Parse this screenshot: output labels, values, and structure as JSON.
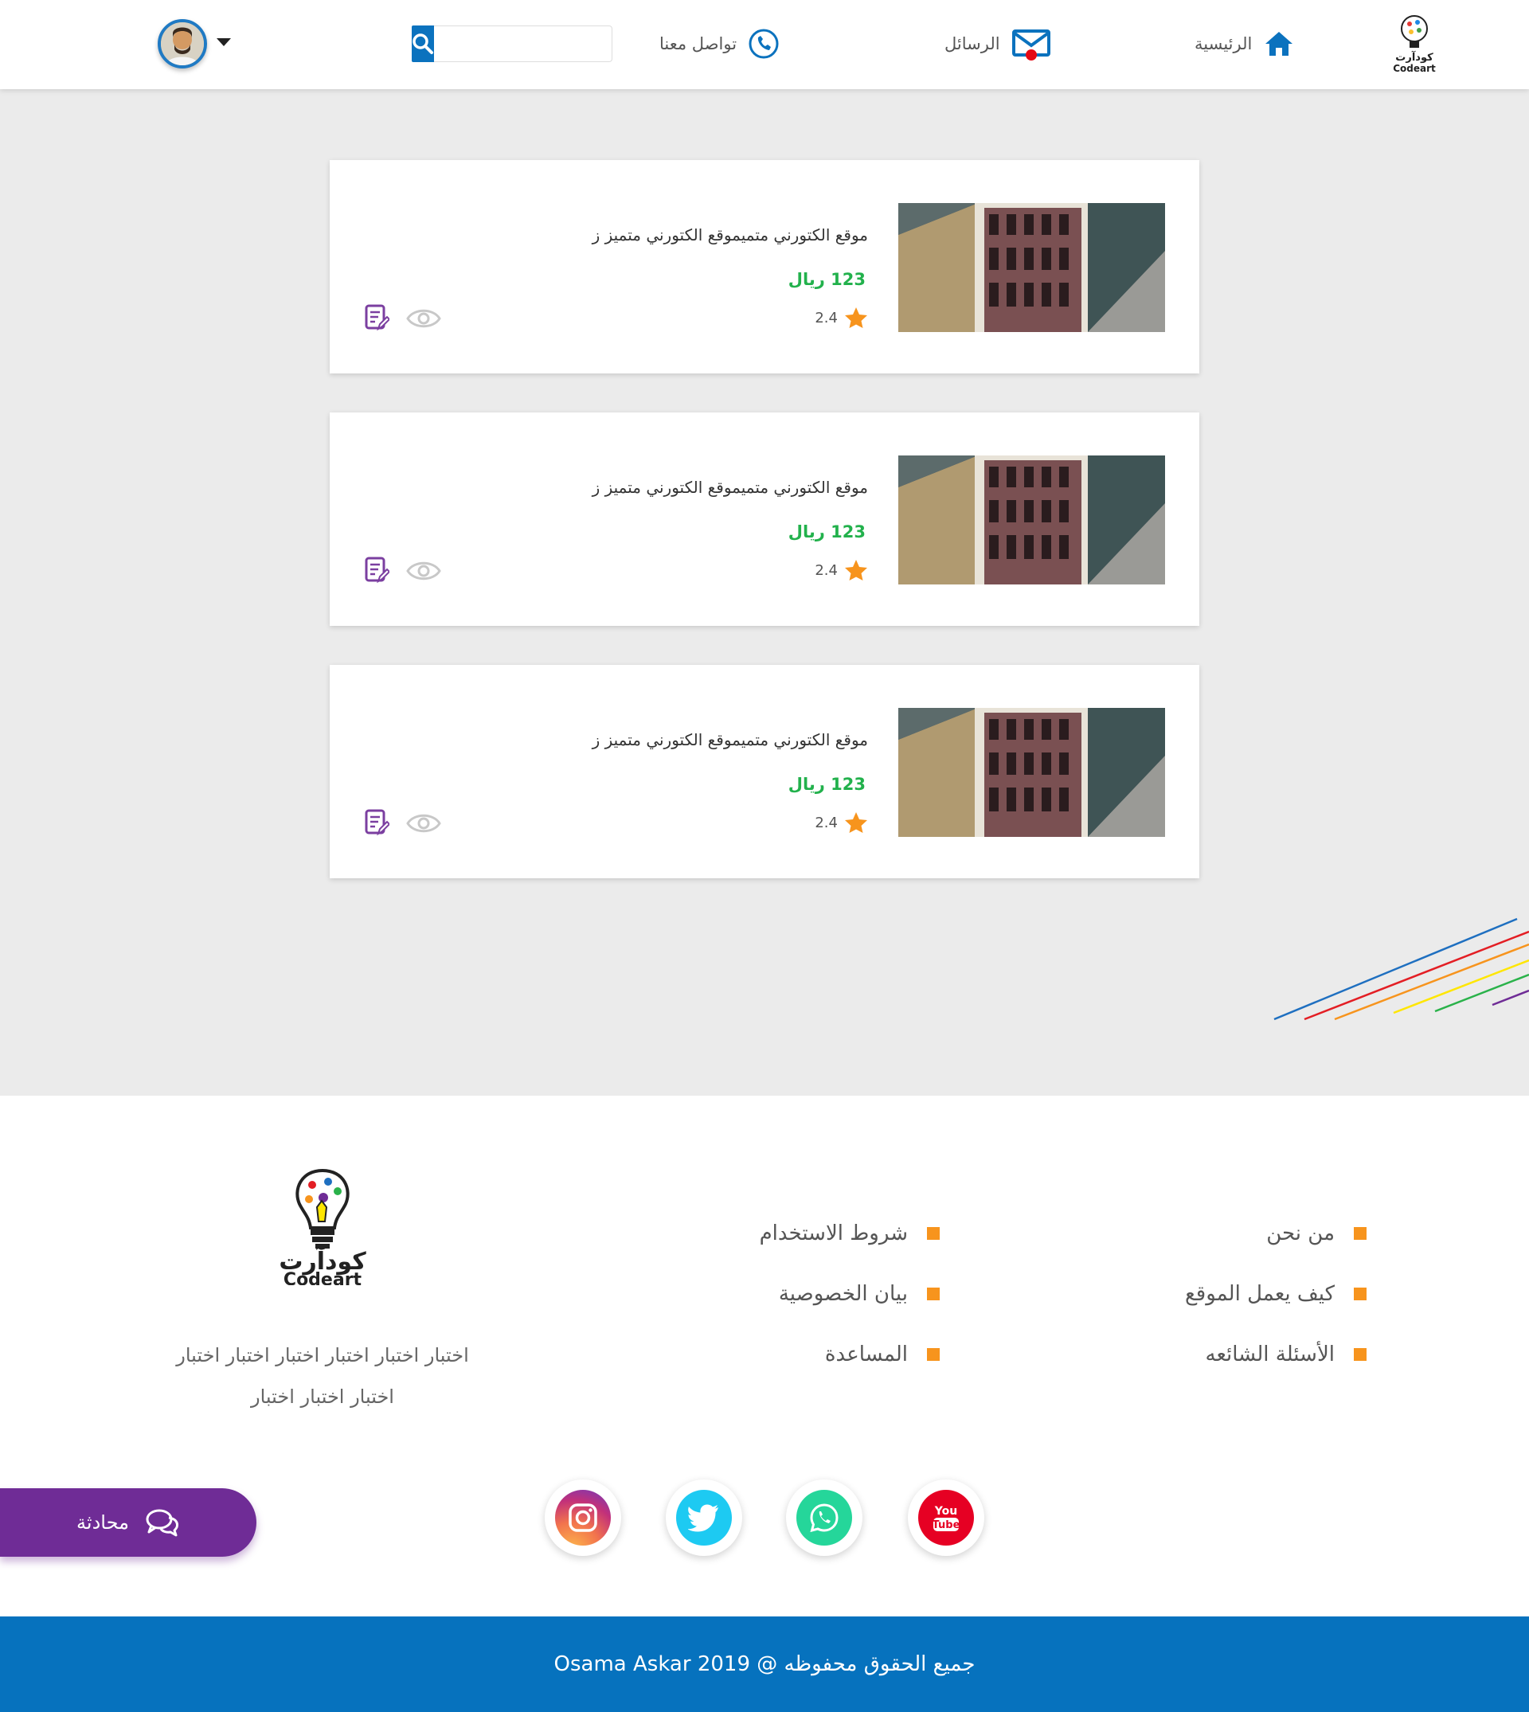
{
  "header": {
    "logo_icon": "codeart-bulb-logo",
    "nav": {
      "home_label": "الرئيسية",
      "messages_label": "الرسائل",
      "contact_label": "تواصل معنا"
    },
    "search": {
      "placeholder": "",
      "value": ""
    },
    "avatar_icon": "user-avatar"
  },
  "cards": [
    {
      "title": "موقع الكتورني متميموقع الكتورني متميز ز",
      "price": "123 ريال",
      "rating": "2.4"
    },
    {
      "title": "موقع الكتورني متميموقع الكتورني متميز ز",
      "price": "123 ريال",
      "rating": "2.4"
    },
    {
      "title": "موقع الكتورني متميموقع الكتورني متميز ز",
      "price": "123 ريال",
      "rating": "2.4"
    }
  ],
  "footer": {
    "brand_ar": "كودآرت",
    "brand_en": "Codeart",
    "description_line1": "اختبار اختبار اختبار اختبار اختبار اختبار",
    "description_line2": "اختبار اختبار اختبار",
    "links_col1": [
      "من نحن",
      "كيف يعمل الموقع",
      "الأسئلة الشائعه"
    ],
    "links_col2": [
      "شروط الاستخدام",
      "بيان الخصوصية",
      "المساعدة"
    ],
    "social": [
      "youtube-icon",
      "whatsapp-icon",
      "twitter-icon",
      "instagram-icon"
    ],
    "copyright": "جميع الحقوق محفوظه @ 2019 Osama Askar"
  },
  "chat": {
    "label": "محادثة"
  },
  "colors": {
    "primary_blue": "#0672be",
    "price_green": "#22b14c",
    "accent_orange": "#f7941d",
    "chat_purple": "#6f2c96"
  }
}
